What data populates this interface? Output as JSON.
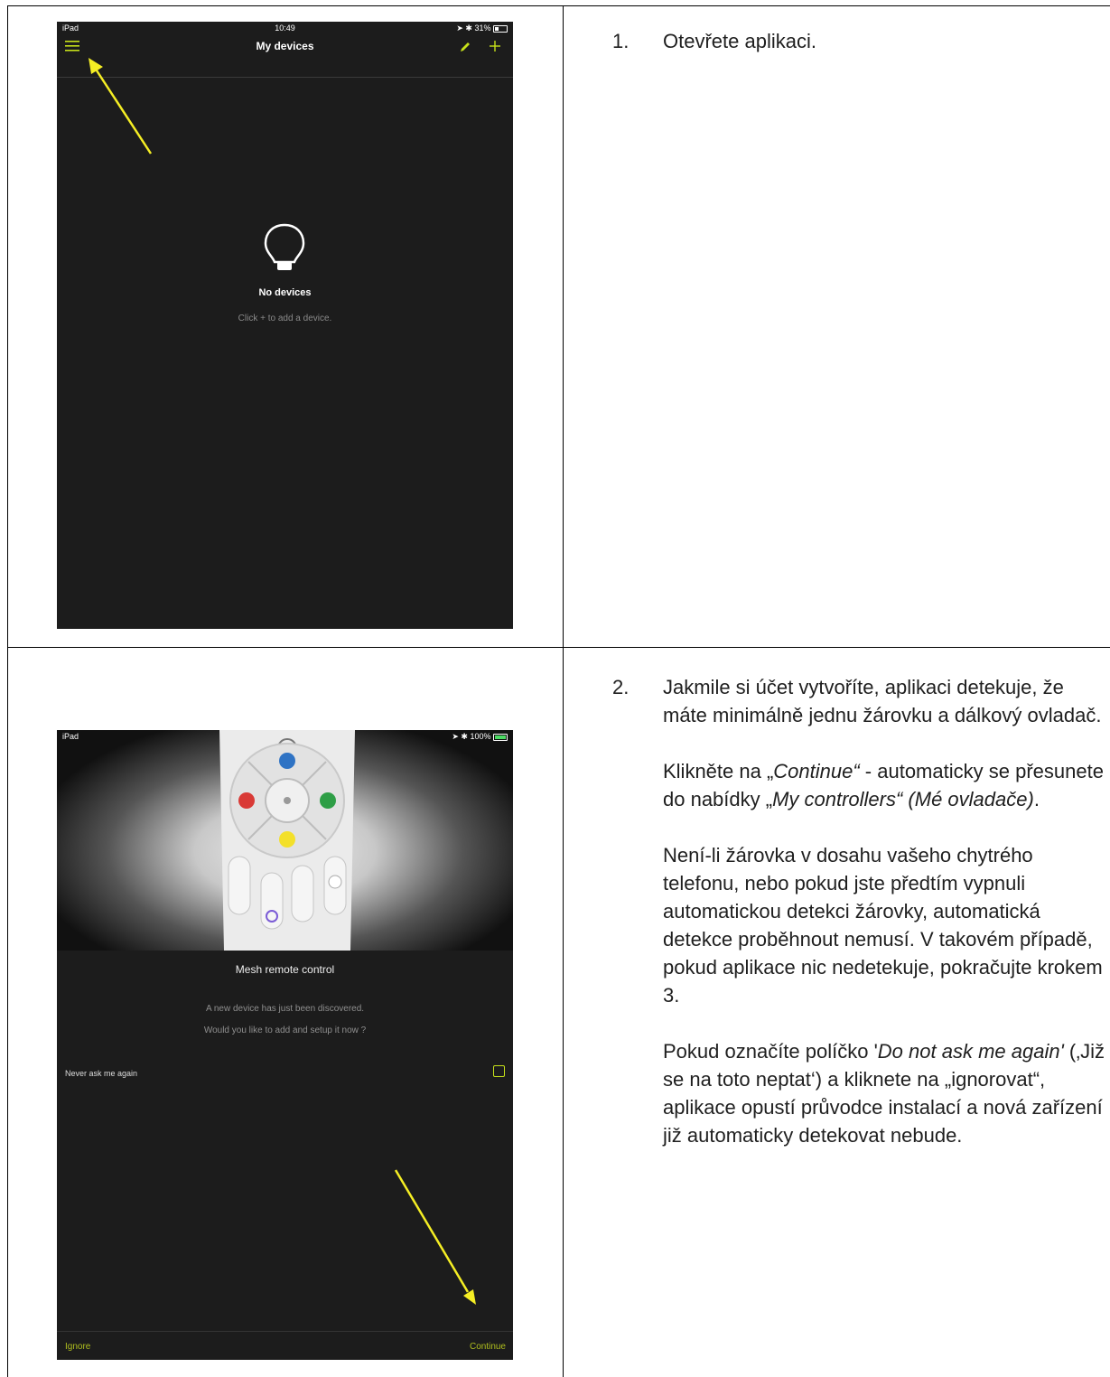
{
  "screen1": {
    "status": {
      "carrier": "iPad",
      "time": "10:49",
      "battery": "31%"
    },
    "title": "My devices",
    "empty_title": "No devices",
    "empty_hint": "Click + to add a device.",
    "accent": "#c6e01a",
    "icons": [
      "menu-icon",
      "pencil-icon",
      "plus-icon",
      "bulb-icon"
    ]
  },
  "step1": {
    "num": "1.",
    "text": "Otevřete aplikaci."
  },
  "screen2": {
    "status": {
      "carrier": "iPad",
      "battery": "100%"
    },
    "device_name": "Mesh remote control",
    "line1": "A new device has just been discovered.",
    "line2": "Would you like to add and setup it now ?",
    "never_label": "Never ask me again",
    "never_checked": false,
    "ignore": "Ignore",
    "continue": "Continue",
    "remote_button_colors": [
      "#2f73c4",
      "#d93a36",
      "#2e9e46",
      "#f3e02a"
    ]
  },
  "step2": {
    "num": "2.",
    "p1": "Jakmile si účet vytvoříte, aplikaci detekuje, že máte minimálně jednu žárovku a dálkový ovladač.",
    "p2_pre": "Klikněte na „",
    "p2_em1": "Continue“",
    "p2_mid": " - automaticky se přesunete do nabídky „",
    "p2_em2": "My controllers“ (Mé ovladače)",
    "p2_post": ".",
    "p3": "Není-li žárovka v dosahu vašeho chytrého telefonu, nebo pokud jste předtím vypnuli automatickou detekci žárovky, automatická detekce proběhnout nemusí. V takovém případě, pokud aplikace nic nedetekuje, pokračujte krokem 3.",
    "p4_pre": "Pokud označíte políčko '",
    "p4_em": "Do not ask me again'",
    "p4_post": " (‚Již se na toto neptat‘) a kliknete na „ignorovat“, aplikace opustí průvodce instalací a nová zařízení již automaticky detekovat nebude."
  }
}
